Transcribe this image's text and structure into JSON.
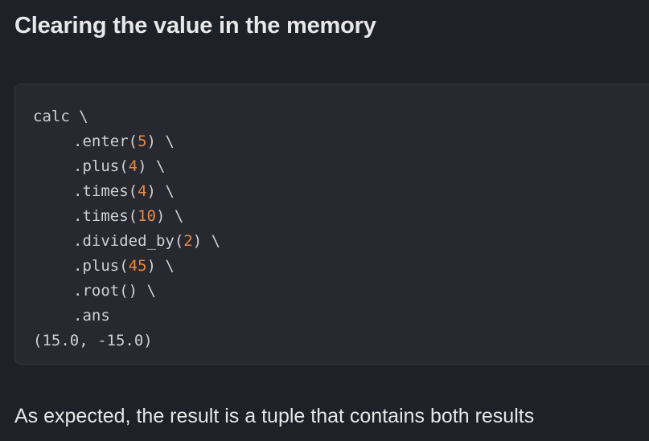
{
  "heading": "Clearing the value in the memory",
  "code": {
    "lines": [
      {
        "indent": false,
        "tokens": [
          {
            "t": "calc \\",
            "k": "plain"
          }
        ]
      },
      {
        "indent": true,
        "tokens": [
          {
            "t": ".enter(",
            "k": "plain"
          },
          {
            "t": "5",
            "k": "num"
          },
          {
            "t": ") \\",
            "k": "plain"
          }
        ]
      },
      {
        "indent": true,
        "tokens": [
          {
            "t": ".plus(",
            "k": "plain"
          },
          {
            "t": "4",
            "k": "num"
          },
          {
            "t": ") \\",
            "k": "plain"
          }
        ]
      },
      {
        "indent": true,
        "tokens": [
          {
            "t": ".times(",
            "k": "plain"
          },
          {
            "t": "4",
            "k": "num"
          },
          {
            "t": ") \\",
            "k": "plain"
          }
        ]
      },
      {
        "indent": true,
        "tokens": [
          {
            "t": ".times(",
            "k": "plain"
          },
          {
            "t": "10",
            "k": "num"
          },
          {
            "t": ") \\",
            "k": "plain"
          }
        ]
      },
      {
        "indent": true,
        "tokens": [
          {
            "t": ".divided_by(",
            "k": "plain"
          },
          {
            "t": "2",
            "k": "num"
          },
          {
            "t": ") \\",
            "k": "plain"
          }
        ]
      },
      {
        "indent": true,
        "tokens": [
          {
            "t": ".plus(",
            "k": "plain"
          },
          {
            "t": "45",
            "k": "num"
          },
          {
            "t": ") \\",
            "k": "plain"
          }
        ]
      },
      {
        "indent": true,
        "tokens": [
          {
            "t": ".root() \\",
            "k": "plain"
          }
        ]
      },
      {
        "indent": true,
        "tokens": [
          {
            "t": ".ans",
            "k": "plain"
          }
        ]
      },
      {
        "indent": false,
        "tokens": [
          {
            "t": "(15.0, -15.0)",
            "k": "plain"
          }
        ]
      }
    ]
  },
  "result_text": "As expected, the result is a tuple that contains both results",
  "colors": {
    "background": "#1f2128",
    "code_background": "#272830",
    "number": "#e68a45",
    "text": "#e6e6e8"
  }
}
